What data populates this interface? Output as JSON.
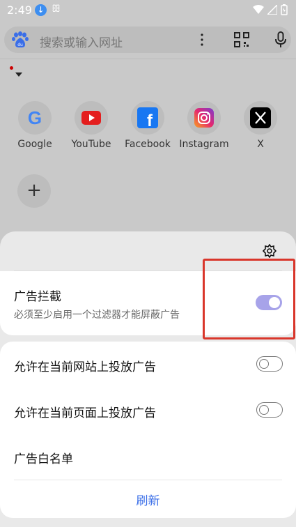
{
  "status_bar": {
    "time": "2:49"
  },
  "search": {
    "placeholder": "搜索或输入网址"
  },
  "shortcuts": [
    {
      "label": "Google",
      "icon": "google-icon"
    },
    {
      "label": "YouTube",
      "icon": "youtube-icon"
    },
    {
      "label": "Facebook",
      "icon": "facebook-icon"
    },
    {
      "label": "Instagram",
      "icon": "instagram-icon"
    },
    {
      "label": "X",
      "icon": "x-icon"
    }
  ],
  "add_shortcut": {
    "symbol": "+"
  },
  "sheet": {
    "ad_block": {
      "title": "广告拦截",
      "subtitle": "必须至少启用一个过滤器才能屏蔽广告",
      "enabled": true
    },
    "allow_site": {
      "label": "允许在当前网站上投放广告",
      "enabled": false
    },
    "allow_page": {
      "label": "允许在当前页面上投放广告",
      "enabled": false
    },
    "whitelist": {
      "label": "广告白名单"
    },
    "refresh": {
      "label": "刷新"
    }
  },
  "colors": {
    "accent": "#3a6ee8",
    "toggle_on": "#a7a3e9",
    "highlight": "#d9362b"
  }
}
